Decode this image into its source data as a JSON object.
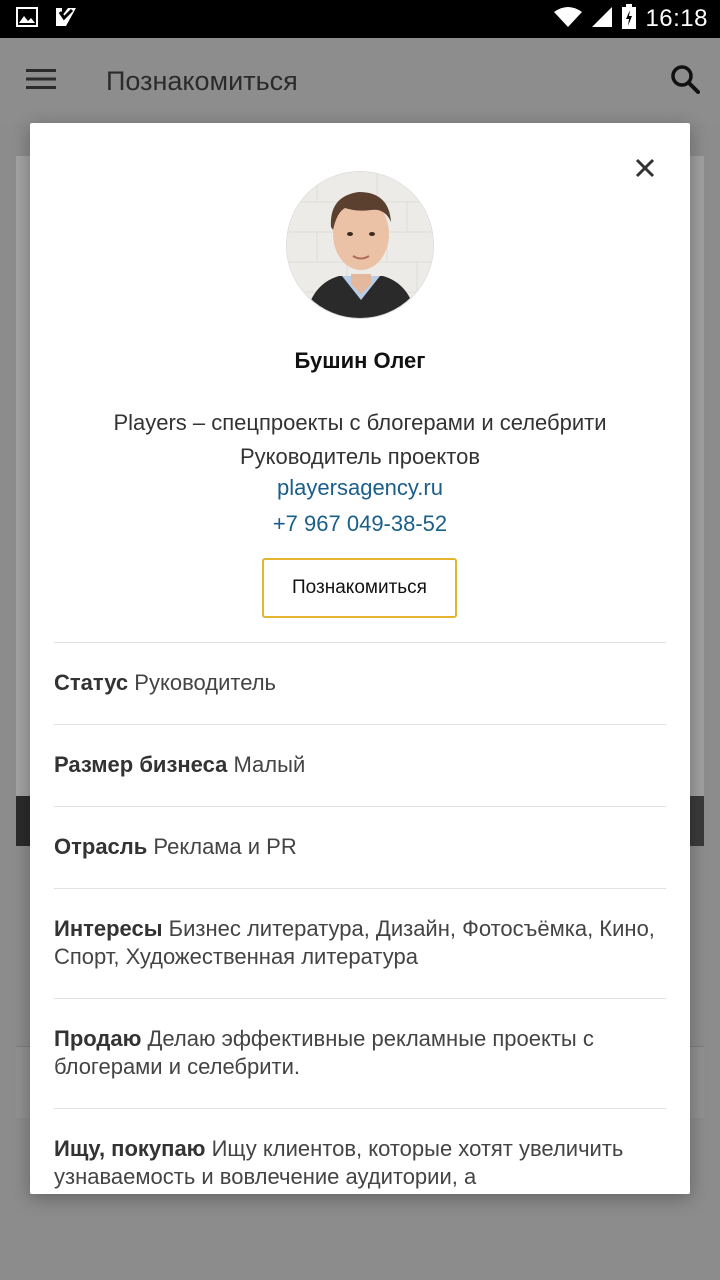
{
  "status_bar": {
    "time": "16:18",
    "icons": [
      "image-icon",
      "notification-icon",
      "wifi-icon",
      "signal-icon",
      "battery-icon"
    ]
  },
  "app_bar": {
    "title": "Познакомиться",
    "menu_icon": "hamburger-menu-icon",
    "search_icon": "search-icon"
  },
  "profile": {
    "name": "Бушин Олег",
    "company": "Players – спецпроекты с блогерами и селебрити",
    "position": "Руководитель проектов",
    "website": "playersagency.ru",
    "phone": "+7 967 049-38-52",
    "meet_button": "Познакомиться"
  },
  "details": [
    {
      "label": "Статус",
      "value": "Руководитель"
    },
    {
      "label": "Размер бизнеса",
      "value": "Малый"
    },
    {
      "label": "Отрасль",
      "value": "Реклама и PR"
    },
    {
      "label": "Интересы",
      "value": "Бизнес литература, Дизайн, Фотосъёмка, Кино, Спорт, Художественная литература"
    },
    {
      "label": "Продаю",
      "value": "Делаю эффективные рекламные проекты с блогерами и селебрити."
    },
    {
      "label": "Ищу, покупаю",
      "value": "Ищу клиентов, которые хотят увеличить узнаваемость и вовлечение аудитории, а"
    }
  ],
  "colors": {
    "link": "#1a5e8a",
    "button_border": "#e6b530",
    "overlay": "#8c8c8c"
  }
}
